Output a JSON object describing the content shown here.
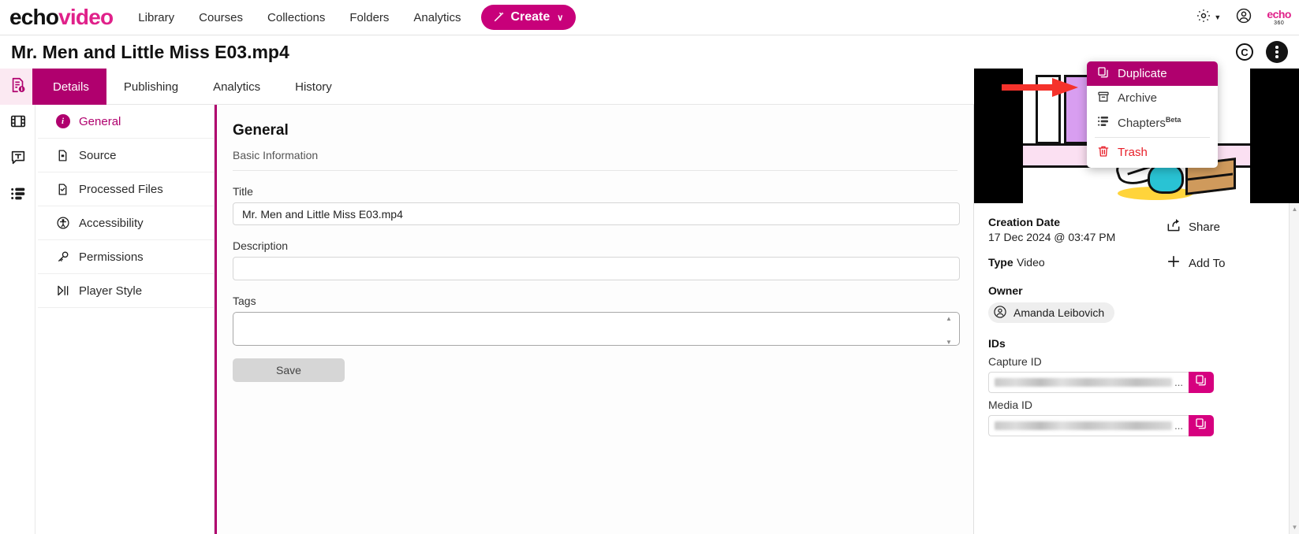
{
  "brand": {
    "part1": "echo",
    "part2": "video"
  },
  "topnav": {
    "links": [
      {
        "label": "Library"
      },
      {
        "label": "Courses"
      },
      {
        "label": "Collections"
      },
      {
        "label": "Folders"
      },
      {
        "label": "Analytics"
      }
    ],
    "create_label": "Create",
    "create_chevron": "∨",
    "wand_icon": "✦",
    "gear_icon": "gear-icon",
    "gear_chevron": "▼",
    "account_icon": "account-icon",
    "echo360": {
      "word": "echo",
      "number": "360"
    }
  },
  "titlebar": {
    "title": "Mr. Men and Little Miss E03.mp4",
    "copyright_symbol": "C",
    "kebab_icon": "kebab-menu-icon"
  },
  "rail": {
    "items": [
      {
        "name": "details-rail-icon",
        "active": true
      },
      {
        "name": "media-rail-icon",
        "active": false
      },
      {
        "name": "captions-rail-icon",
        "active": false
      },
      {
        "name": "list-rail-icon",
        "active": false
      }
    ]
  },
  "tabs": [
    {
      "label": "Details",
      "active": true
    },
    {
      "label": "Publishing",
      "active": false
    },
    {
      "label": "Analytics",
      "active": false
    },
    {
      "label": "History",
      "active": false
    }
  ],
  "subnav": {
    "items": [
      {
        "label": "General",
        "icon": "info-icon",
        "active": true
      },
      {
        "label": "Source",
        "icon": "source-file-icon",
        "active": false
      },
      {
        "label": "Processed Files",
        "icon": "processed-file-icon",
        "active": false
      },
      {
        "label": "Accessibility",
        "icon": "accessibility-icon",
        "active": false
      },
      {
        "label": "Permissions",
        "icon": "key-icon",
        "active": false
      },
      {
        "label": "Player Style",
        "icon": "player-style-icon",
        "active": false
      }
    ]
  },
  "main": {
    "heading": "General",
    "subheading": "Basic Information",
    "fields": {
      "title_label": "Title",
      "title_value": "Mr. Men and Little Miss E03.mp4",
      "title_placeholder": "",
      "description_label": "Description",
      "description_value": "",
      "description_placeholder": "",
      "tags_label": "Tags",
      "tags_value": "",
      "tags_placeholder": ""
    },
    "save_label": "Save"
  },
  "dropdown": {
    "items": [
      {
        "label": "Duplicate",
        "icon": "duplicate-icon",
        "highlighted": true,
        "danger": false
      },
      {
        "label": "Archive",
        "icon": "archive-icon",
        "highlighted": false,
        "danger": false
      },
      {
        "label": "Chapters",
        "sup": "Beta",
        "icon": "chapters-icon",
        "highlighted": false,
        "danger": false
      },
      {
        "label": "Trash",
        "icon": "trash-icon",
        "highlighted": false,
        "danger": true
      }
    ]
  },
  "details_panel": {
    "creation_date_label": "Creation Date",
    "creation_date_value": "17 Dec 2024 @ 03:47 PM",
    "type_label": "Type",
    "type_value": "Video",
    "owner_label": "Owner",
    "owner_name": "Amanda Leibovich",
    "share_label": "Share",
    "add_to_label": "Add To",
    "ids_label": "IDs",
    "capture_id_label": "Capture ID",
    "capture_id_value": "",
    "capture_id_ellipsis": "...",
    "media_id_label": "Media ID",
    "media_id_value": "",
    "media_id_ellipsis": "...",
    "copy_icon": "copy-icon"
  },
  "colors": {
    "brand_pink": "#e0218a",
    "accent_magenta": "#b0006e",
    "create_pink": "#c8007a",
    "copy_pink": "#d6007f",
    "danger_red": "#e8202a",
    "arrow_red": "#f5322b"
  },
  "scrollbar": {
    "up_arrow": "▲",
    "down_arrow": "▼"
  }
}
